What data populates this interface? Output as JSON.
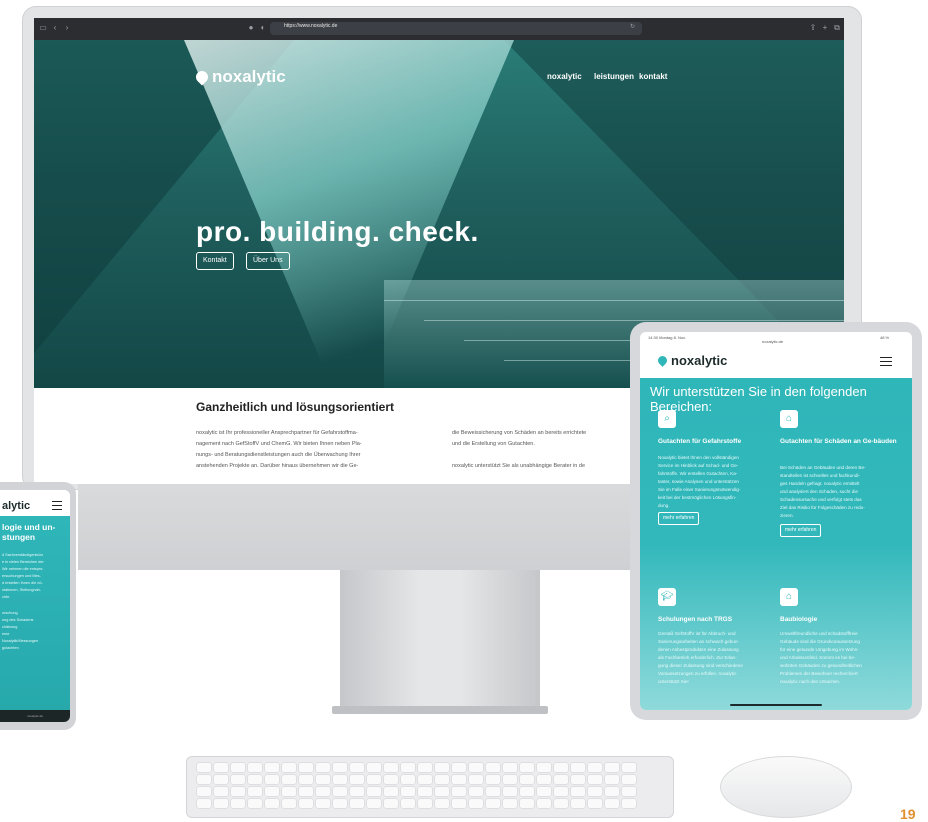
{
  "browser": {
    "url": "https://www.noxalytic.de"
  },
  "desktop": {
    "logo": "noxalytic",
    "nav": [
      "noxalytic",
      "leistungen",
      "kontakt"
    ],
    "hero_title": "pro. building. check.",
    "hero_buttons": [
      "Kontakt",
      "Über Uns"
    ],
    "section_title": "Ganzheitlich und lösungsorientiert",
    "col1": [
      "noxalytic ist Ihr professioneller Ansprechpartner für Gefahrstoffma-",
      "nagement nach GefStoffV und ChemG. Wir bieten Ihnen neben Pla-",
      "nungs- und Beratungsdienstleistungen auch die Überwachung Ihrer",
      "anstehenden Projekte an. Darüber hinaus übernehmen wir die Ge-"
    ],
    "col2": [
      "die Beweissicherung von Schäden an bereits errichtete",
      "und die Erstellung von Gutachten.",
      "",
      "noxalytic unterstützt Sie als unabhängige Berater in de"
    ]
  },
  "tablet": {
    "status_left": "14:30  Montag 8. Nov.",
    "status_center": "noxalytic.de",
    "status_right": "48 %",
    "logo": "noxalytic",
    "heading": "Wir unterstützen Sie in den folgenden Bereichen:",
    "cards": [
      {
        "title": "Gutachten für Gefahrstoffe",
        "lines": [
          "Noxalytic bietet Ihnen den vollständigen",
          "Service im Hinblick auf Schad- und Ge-",
          "fahrstoffe. Wir erstellen Gutachten, Ka-",
          "taster, sowie Analysen und unterstützen",
          "Sie im Falle einer Sanierungsnotwendig-",
          "keit bei der bestmöglichen Lösungsfin-",
          "dung."
        ],
        "more": "mehr erfahren"
      },
      {
        "title": "Gutachten für Schäden an Ge-bäuden",
        "lines": [
          "Bei Schäden an Gebäuden und deren Be-",
          "standteilen ist schnelles und fachkundi-",
          "ges Handeln gefragt. noxalytic ermittelt",
          "und analysiert den Schaden, sucht die",
          "Schadensursache und verfolgt stets das",
          "Ziel das Risiko für Folgeschäden zu redu-",
          "zieren."
        ],
        "more": "mehr erfahren"
      },
      {
        "title": "Schulungen nach TRGS",
        "lines": [
          "Gemäß GefStoffV ist für Abbruch- und",
          "Sanierungsarbeiten an schwach gebun-",
          "denen Asbestprodukten eine Zulassung",
          "als Fachbetrieb erforderlich. Zur Erlan-",
          "gung dieser Zulassung sind verschiedene",
          "Voraussetzungen zu erfüllen. noxalytic",
          "unterstützt Sie!"
        ]
      },
      {
        "title": "Baubiologie",
        "lines": [
          "Umweltfreundliche und schadstofffreie",
          "Gebäude sind die Grundvoraussetzung",
          "für eine gesunde Umgebung im Wohn-",
          "und Arbeitsumfeld. Kommt es bei be-",
          "wohnten Gebäuden zu gesundheitlichen",
          "Problemen der Bewohner recherchiert",
          "noxalytic nach den Ursachen."
        ]
      }
    ]
  },
  "phone": {
    "logo": "alytic",
    "heading": [
      "logie und un-",
      "stungen"
    ],
    "lines": [
      "d Sachverständigenbüro",
      "e in vielen Bereichen der",
      "Wir nehmen die entspre-",
      "ersuchungen und Mes-",
      "d erstellen Ihnen die nö-",
      "ntationen, Stellungnah-",
      "chte."
    ],
    "list": [
      "orschung",
      "ung des Schadens",
      "chätzung",
      "eme",
      "Noxalytik/Messungen",
      "gutachten"
    ],
    "bottom": "noxalytic.de"
  },
  "page_number": "19"
}
